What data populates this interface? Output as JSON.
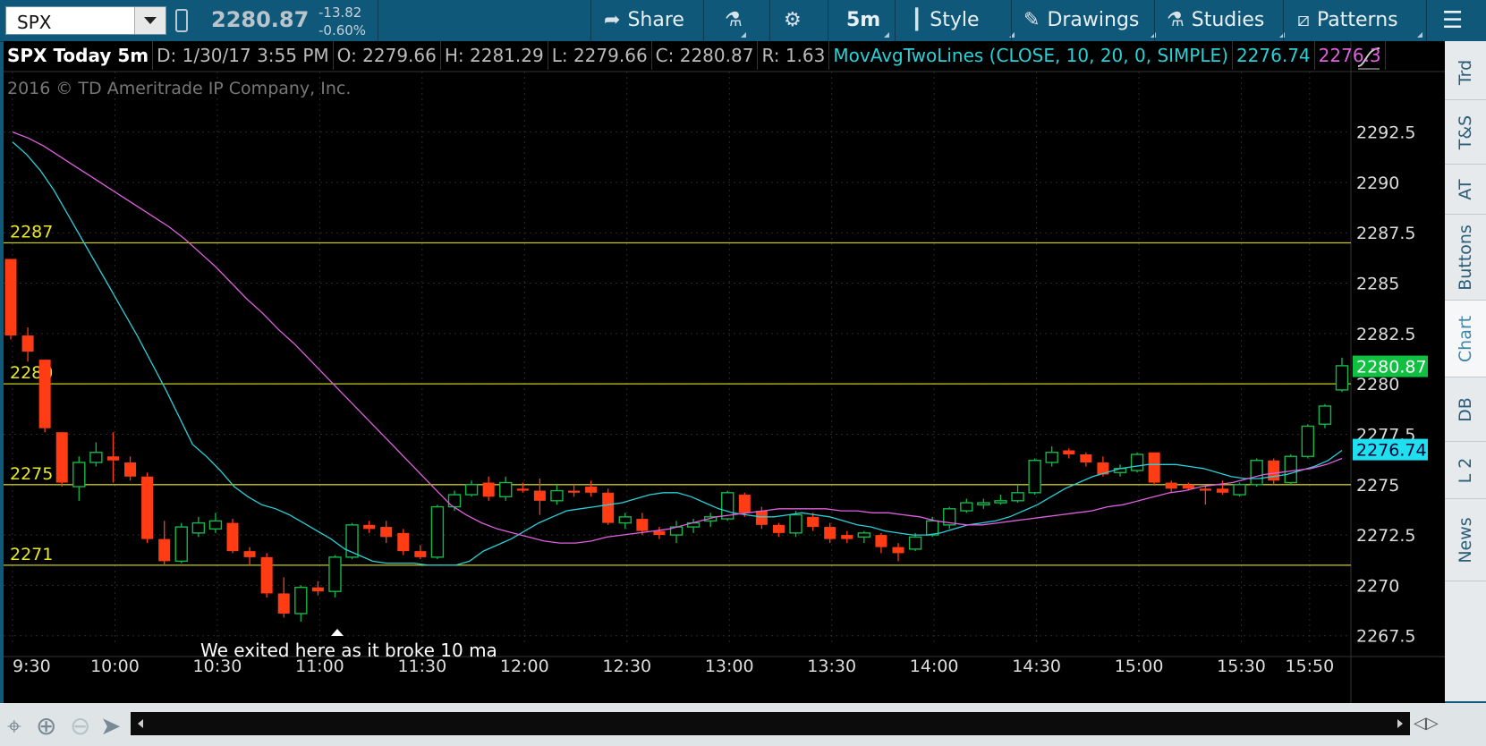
{
  "toolbar": {
    "symbol": "SPX",
    "last_price": "2280.87",
    "net_change": "-13.82",
    "pct_change": "-0.60%",
    "share_label": "Share",
    "timeframe_label": "5m",
    "style_label": "Style",
    "drawings_label": "Drawings",
    "studies_label": "Studies",
    "patterns_label": "Patterns"
  },
  "header": {
    "title": "SPX Today 5m",
    "date": "D: 1/30/17 3:55 PM",
    "open": "O: 2279.66",
    "high": "H: 2281.29",
    "low": "L: 2279.66",
    "close": "C: 2280.87",
    "range": "R: 1.63",
    "study": "MovAvgTwoLines (CLOSE, 10, 20, 0, SIMPLE)",
    "ma1_value": "2276.74",
    "ma2_value": "2276.3"
  },
  "copyright": "2016 © TD Ameritrade IP Company, Inc.",
  "annotation": "We exited here as it broke 10 ma",
  "right_tabs": [
    "Trd",
    "T&S",
    "AT",
    "Buttons",
    "Chart",
    "DB",
    "L 2",
    "News"
  ],
  "active_tab": "Chart",
  "colors": {
    "up": "#11b84a",
    "down": "#ff3c14",
    "ma_fast": "#2ad0d8",
    "ma_slow": "#e060e0",
    "hline": "#c8c820"
  },
  "chart_data": {
    "type": "candlestick",
    "x_ticks": [
      "9:30",
      "10:00",
      "10:30",
      "11:00",
      "11:30",
      "12:00",
      "12:30",
      "13:00",
      "13:30",
      "14:00",
      "14:30",
      "15:00",
      "15:30",
      "15:50"
    ],
    "y_ticks": [
      "2292.5",
      "2290",
      "2287.5",
      "2285",
      "2282.5",
      "2280",
      "2277.5",
      "2275",
      "2272.5",
      "2270",
      "2267.5"
    ],
    "ylim": [
      2267,
      2295.5
    ],
    "grid": true,
    "last_price_label": "2280.87",
    "ma_fast_label": "2276.74",
    "horizontal_lines": [
      {
        "value": 2287,
        "label": "2287"
      },
      {
        "value": 2280,
        "label": "2280"
      },
      {
        "value": 2275,
        "label": "2275"
      },
      {
        "value": 2271,
        "label": "2271"
      }
    ],
    "candles": [
      [
        2286.2,
        2286.2,
        2282.2,
        2282.4
      ],
      [
        2282.4,
        2282.8,
        2281.1,
        2281.6
      ],
      [
        2281.2,
        2281.2,
        2277.6,
        2277.8
      ],
      [
        2277.6,
        2277.6,
        2274.9,
        2275.1
      ],
      [
        2274.9,
        2276.4,
        2274.2,
        2276.1
      ],
      [
        2276.1,
        2277.1,
        2275.9,
        2276.6
      ],
      [
        2276.4,
        2277.6,
        2275.1,
        2276.2
      ],
      [
        2276.1,
        2276.4,
        2275.2,
        2275.4
      ],
      [
        2275.4,
        2275.6,
        2272.1,
        2272.3
      ],
      [
        2272.3,
        2273.2,
        2271.0,
        2271.2
      ],
      [
        2271.2,
        2273.1,
        2271.1,
        2272.9
      ],
      [
        2272.6,
        2273.4,
        2272.4,
        2273.1
      ],
      [
        2272.8,
        2273.6,
        2272.6,
        2273.2
      ],
      [
        2273.1,
        2273.3,
        2271.6,
        2271.7
      ],
      [
        2271.7,
        2271.9,
        2271.0,
        2271.4
      ],
      [
        2271.4,
        2271.6,
        2269.4,
        2269.6
      ],
      [
        2269.6,
        2270.4,
        2268.4,
        2268.6
      ],
      [
        2268.6,
        2270.0,
        2268.2,
        2269.9
      ],
      [
        2269.9,
        2270.2,
        2269.5,
        2269.7
      ],
      [
        2269.7,
        2271.5,
        2269.4,
        2271.4
      ],
      [
        2271.4,
        2273.1,
        2271.3,
        2273.0
      ],
      [
        2273.0,
        2273.2,
        2272.6,
        2272.8
      ],
      [
        2272.9,
        2273.2,
        2272.1,
        2272.4
      ],
      [
        2272.6,
        2272.8,
        2271.5,
        2271.7
      ],
      [
        2271.7,
        2272.0,
        2271.3,
        2271.4
      ],
      [
        2271.4,
        2274.0,
        2271.3,
        2273.9
      ],
      [
        2273.9,
        2274.7,
        2273.7,
        2274.5
      ],
      [
        2274.5,
        2275.2,
        2274.4,
        2275.0
      ],
      [
        2275.1,
        2275.4,
        2274.2,
        2274.4
      ],
      [
        2274.4,
        2275.4,
        2274.2,
        2275.1
      ],
      [
        2274.8,
        2275.1,
        2274.6,
        2274.7
      ],
      [
        2274.7,
        2275.3,
        2273.5,
        2274.2
      ],
      [
        2274.2,
        2275.0,
        2274.0,
        2274.7
      ],
      [
        2274.7,
        2275.0,
        2274.4,
        2274.6
      ],
      [
        2274.9,
        2275.2,
        2274.4,
        2274.6
      ],
      [
        2274.6,
        2274.8,
        2273.0,
        2273.1
      ],
      [
        2273.1,
        2273.6,
        2272.8,
        2273.4
      ],
      [
        2273.3,
        2273.6,
        2272.5,
        2272.7
      ],
      [
        2272.7,
        2272.9,
        2272.3,
        2272.5
      ],
      [
        2272.5,
        2273.2,
        2272.1,
        2272.9
      ],
      [
        2272.9,
        2273.3,
        2272.6,
        2273.1
      ],
      [
        2273.2,
        2273.6,
        2272.9,
        2273.4
      ],
      [
        2273.3,
        2274.7,
        2273.2,
        2274.6
      ],
      [
        2274.5,
        2274.6,
        2273.4,
        2273.6
      ],
      [
        2273.7,
        2273.9,
        2272.8,
        2273.0
      ],
      [
        2273.0,
        2273.1,
        2272.4,
        2272.6
      ],
      [
        2272.6,
        2273.7,
        2272.4,
        2273.5
      ],
      [
        2273.4,
        2273.6,
        2272.7,
        2272.9
      ],
      [
        2272.9,
        2273.1,
        2272.1,
        2272.3
      ],
      [
        2272.5,
        2272.7,
        2272.1,
        2272.3
      ],
      [
        2272.4,
        2272.7,
        2272.1,
        2272.6
      ],
      [
        2272.5,
        2272.6,
        2271.6,
        2271.9
      ],
      [
        2271.9,
        2272.1,
        2271.2,
        2271.6
      ],
      [
        2271.8,
        2272.6,
        2271.7,
        2272.4
      ],
      [
        2272.5,
        2273.4,
        2272.4,
        2273.2
      ],
      [
        2273.0,
        2273.9,
        2272.8,
        2273.8
      ],
      [
        2273.7,
        2274.3,
        2273.6,
        2274.1
      ],
      [
        2274.0,
        2274.3,
        2273.8,
        2274.1
      ],
      [
        2274.1,
        2274.5,
        2274.0,
        2274.2
      ],
      [
        2274.2,
        2275.0,
        2274.1,
        2274.6
      ],
      [
        2274.6,
        2276.3,
        2274.5,
        2276.2
      ],
      [
        2276.1,
        2276.9,
        2275.9,
        2276.6
      ],
      [
        2276.7,
        2276.8,
        2276.3,
        2276.5
      ],
      [
        2276.5,
        2276.6,
        2275.9,
        2276.1
      ],
      [
        2276.1,
        2276.4,
        2275.4,
        2275.5
      ],
      [
        2275.6,
        2276.0,
        2275.4,
        2275.8
      ],
      [
        2275.7,
        2276.6,
        2275.6,
        2276.5
      ],
      [
        2276.6,
        2276.6,
        2275.0,
        2275.1
      ],
      [
        2275.1,
        2275.2,
        2274.6,
        2274.8
      ],
      [
        2275.0,
        2275.1,
        2274.7,
        2274.8
      ],
      [
        2274.8,
        2274.9,
        2274.0,
        2274.7
      ],
      [
        2274.8,
        2275.2,
        2274.5,
        2274.6
      ],
      [
        2274.5,
        2275.1,
        2274.4,
        2275.0
      ],
      [
        2275.0,
        2276.3,
        2274.9,
        2276.2
      ],
      [
        2276.2,
        2276.3,
        2275.0,
        2275.2
      ],
      [
        2275.1,
        2276.5,
        2275.0,
        2276.4
      ],
      [
        2276.4,
        2278.0,
        2276.3,
        2277.9
      ],
      [
        2278.0,
        2279.0,
        2277.8,
        2278.9
      ],
      [
        2279.7,
        2281.3,
        2279.6,
        2280.9
      ]
    ],
    "series": [
      {
        "name": "MovAvgTwoLines 10",
        "values": [
          2292,
          2291.4,
          2290.6,
          2289.6,
          2288.4,
          2287.2,
          2286,
          2284.8,
          2283.6,
          2282.4,
          2281.1,
          2279.8,
          2278.4,
          2277,
          2276.4,
          2275.7,
          2274.9,
          2274.4,
          2274,
          2273.8,
          2273.5,
          2273.1,
          2272.7,
          2272.3,
          2271.8,
          2271.5,
          2271.2,
          2271.1,
          2271.1,
          2271.1,
          2271.0,
          2271.0,
          2271.0,
          2271.2,
          2271.7,
          2272.0,
          2272.3,
          2272.7,
          2273.1,
          2273.4,
          2273.7,
          2273.8,
          2273.9,
          2274.0,
          2274.1,
          2274.3,
          2274.5,
          2274.6,
          2274.6,
          2274.4,
          2274.1,
          2273.8,
          2273.6,
          2273.5,
          2273.4,
          2273.4,
          2273.5,
          2273.6,
          2273.5,
          2273.4,
          2273.2,
          2273.0,
          2272.9,
          2272.7,
          2272.6,
          2272.5,
          2272.5,
          2272.6,
          2272.8,
          2273.0,
          2273.1,
          2273.2,
          2273.4,
          2273.7,
          2274.0,
          2274.4,
          2274.8,
          2275.1,
          2275.4,
          2275.6,
          2275.8,
          2275.9,
          2276.0,
          2276.0,
          2276.0,
          2275.9,
          2275.8,
          2275.6,
          2275.4,
          2275.3,
          2275.3,
          2275.4,
          2275.5,
          2275.7,
          2275.9,
          2276.2,
          2276.7
        ]
      },
      {
        "name": "MovAvgTwoLines 20",
        "values": [
          2292.5,
          2292.2,
          2291.8,
          2291.3,
          2290.8,
          2290.3,
          2289.8,
          2289.3,
          2288.8,
          2288.3,
          2287.8,
          2287.2,
          2286.5,
          2285.8,
          2285,
          2284.2,
          2283.5,
          2282.7,
          2282,
          2281.2,
          2280.4,
          2279.6,
          2278.8,
          2278,
          2277.2,
          2276.4,
          2275.6,
          2274.8,
          2274,
          2273.5,
          2273.1,
          2272.8,
          2272.6,
          2272.4,
          2272.2,
          2272.1,
          2272.1,
          2272.2,
          2272.4,
          2272.5,
          2272.6,
          2272.7,
          2272.8,
          2273.0,
          2273.2,
          2273.4,
          2273.5,
          2273.6,
          2273.7,
          2273.8,
          2273.8,
          2273.8,
          2273.8,
          2273.7,
          2273.7,
          2273.6,
          2273.6,
          2273.5,
          2273.4,
          2273.2,
          2273.1,
          2273.0,
          2273.0,
          2273.1,
          2273.2,
          2273.3,
          2273.4,
          2273.5,
          2273.6,
          2273.7,
          2273.9,
          2274.0,
          2274.2,
          2274.4,
          2274.6,
          2274.7,
          2274.9,
          2275.0,
          2275.1,
          2275.3,
          2275.5,
          2275.6,
          2275.7,
          2275.8,
          2276.0,
          2276.3
        ]
      }
    ]
  }
}
